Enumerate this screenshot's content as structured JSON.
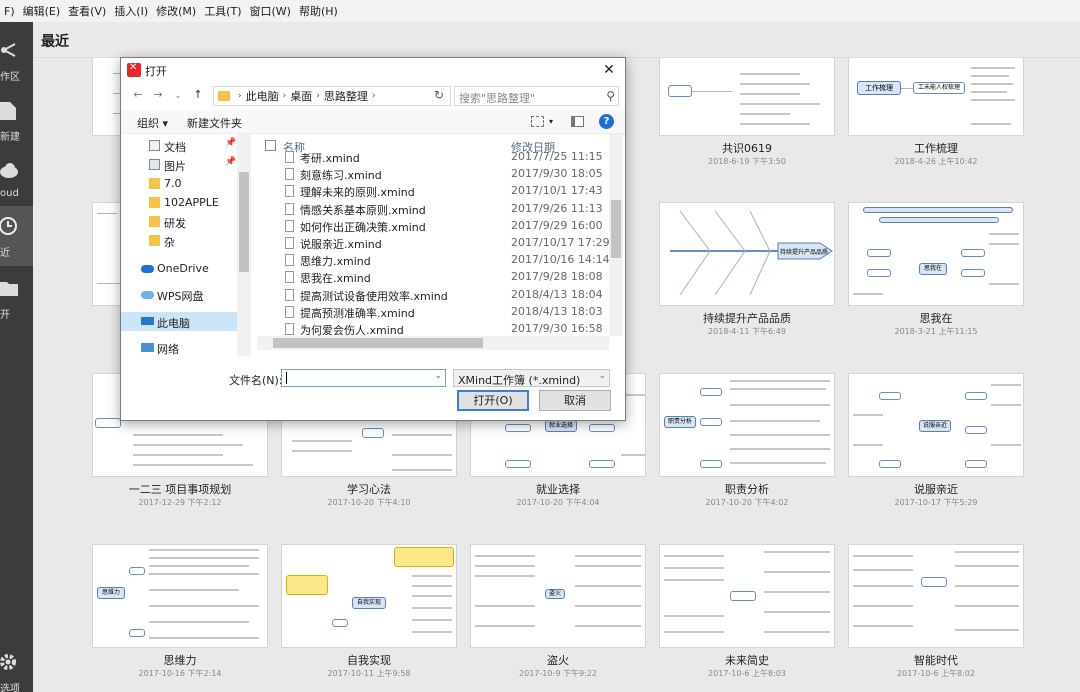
{
  "menu": [
    "F)",
    "编辑(E)",
    "查看(V)",
    "插入(I)",
    "修改(M)",
    "工具(T)",
    "窗口(W)",
    "帮助(H)"
  ],
  "sidebar": {
    "items": [
      {
        "label": "作区",
        "icon": "workspace-icon"
      },
      {
        "label": "新建",
        "icon": "new-file-icon"
      },
      {
        "label": "oud",
        "icon": "cloud-icon"
      },
      {
        "label": "近",
        "icon": "clock-icon"
      },
      {
        "label": "开",
        "icon": "folder-icon"
      },
      {
        "label": "选项",
        "icon": "gear-icon"
      }
    ]
  },
  "header": {
    "title": "最近"
  },
  "cards": [
    {
      "name": "",
      "date": ""
    },
    {
      "name": "共识0619",
      "date": "2018-6-19 下午3:50"
    },
    {
      "name": "工作梳理",
      "date": "2018-4-26 上午10:42"
    },
    {
      "name": "",
      "date": ""
    },
    {
      "name": "持续提升产品品质",
      "date": "2018-4-11 下午6:49"
    },
    {
      "name": "思我在",
      "date": "2018-3-21 上午11:15"
    },
    {
      "name": "一二三 项目事项规划",
      "date": "2017-12-29 下午2:12"
    },
    {
      "name": "学习心法",
      "date": "2017-10-20 下午4:10"
    },
    {
      "name": "就业选择",
      "date": "2017-10-20 下午4:04"
    },
    {
      "name": "职责分析",
      "date": "2017-10-20 下午4:02"
    },
    {
      "name": "说服亲近",
      "date": "2017-10-17 下午5:29"
    },
    {
      "name": "思维力",
      "date": "2017-10-16 下午2:14"
    },
    {
      "name": "自我实现",
      "date": "2017-10-11 上午9:58"
    },
    {
      "name": "盗火",
      "date": "2017-10-9 下午9:22"
    },
    {
      "name": "未来简史",
      "date": "2017-10-6 上午8:03"
    },
    {
      "name": "智能时代",
      "date": "2017-10-6 上午8:02"
    }
  ],
  "thumb_labels": {
    "gongshi": "",
    "gongzuo_center": "工作梳理",
    "gongzuo_branch": "工未能人权梳理",
    "chixu_center": "持续提升产品品质",
    "siwo_center": "思我在",
    "jiuye_center": "就业选择",
    "zhize_center": "职责分析",
    "shuofu_center": "说服亲近",
    "siweili_center": "思维力",
    "ziwo_center": "自我实现",
    "daohuo_center": "盗火"
  },
  "dialog": {
    "title": "打开",
    "breadcrumb": [
      "此电脑",
      "桌面",
      "思路整理"
    ],
    "search_placeholder": "搜索\"思路整理\"",
    "organize": "组织",
    "new_folder": "新建文件夹",
    "nav_items": [
      {
        "label": "文档",
        "icon": "documents-icon",
        "pinned": true
      },
      {
        "label": "图片",
        "icon": "pictures-icon",
        "pinned": true
      },
      {
        "label": "7.0",
        "icon": "folder-icon",
        "pinned": false
      },
      {
        "label": "102APPLE",
        "icon": "folder-icon",
        "pinned": false
      },
      {
        "label": "研发",
        "icon": "folder-icon",
        "pinned": false
      },
      {
        "label": "杂",
        "icon": "folder-icon",
        "pinned": false
      },
      {
        "label": "OneDrive",
        "icon": "onedrive-icon",
        "pinned": false
      },
      {
        "label": "WPS网盘",
        "icon": "wps-cloud-icon",
        "pinned": false
      },
      {
        "label": "此电脑",
        "icon": "computer-icon",
        "pinned": false
      },
      {
        "label": "网络",
        "icon": "network-icon",
        "pinned": false
      }
    ],
    "columns": {
      "name": "名称",
      "date": "修改日期"
    },
    "files": [
      {
        "name": "考研.xmind",
        "date": "2017/7/25 11:15"
      },
      {
        "name": "刻意练习.xmind",
        "date": "2017/9/30 18:05"
      },
      {
        "name": "理解未来的原则.xmind",
        "date": "2017/10/1 17:43"
      },
      {
        "name": "情感关系基本原则.xmind",
        "date": "2017/9/26 11:13"
      },
      {
        "name": "如何作出正确决策.xmind",
        "date": "2017/9/29 16:00"
      },
      {
        "name": "说服亲近.xmind",
        "date": "2017/10/17 17:29"
      },
      {
        "name": "思维力.xmind",
        "date": "2017/10/16 14:14"
      },
      {
        "name": "思我在.xmind",
        "date": "2017/9/28 18:08"
      },
      {
        "name": "提高测试设备使用效率.xmind",
        "date": "2018/4/13 18:04"
      },
      {
        "name": "提高预测准确率.xmind",
        "date": "2018/4/13 18:03"
      },
      {
        "name": "为何爱会伤人.xmind",
        "date": "2017/9/30 16:58"
      }
    ],
    "filename_label": "文件名(N):",
    "filename_value": "",
    "filter": "XMind工作簿 (*.xmind)",
    "open_button": "打开(O)",
    "cancel_button": "取消"
  }
}
